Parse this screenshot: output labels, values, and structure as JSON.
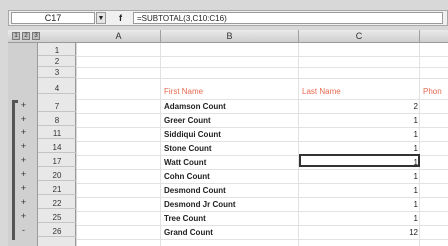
{
  "formula_bar": {
    "name_box": "C17",
    "fx": "f",
    "formula": "=SUBTOTAL(3,C10:C16)"
  },
  "outline_levels": [
    "1",
    "2",
    "3"
  ],
  "columns": [
    "A",
    "B",
    "C"
  ],
  "row_numbers": [
    "1",
    "2",
    "3",
    "4",
    "7",
    "8",
    "11",
    "14",
    "17",
    "20",
    "21",
    "22",
    "25",
    "26"
  ],
  "headers": {
    "first_name": "First Name",
    "last_name": "Last Name",
    "extra": "Phon"
  },
  "rows": [
    {
      "label": "Adamson Count",
      "value": "2"
    },
    {
      "label": "Greer Count",
      "value": "1"
    },
    {
      "label": "Siddiqui Count",
      "value": "1"
    },
    {
      "label": "Stone Count",
      "value": "1"
    },
    {
      "label": "Watt Count",
      "value": "1"
    },
    {
      "label": "Cohn Count",
      "value": "1"
    },
    {
      "label": "Desmond Count",
      "value": "1"
    },
    {
      "label": "Desmond Jr Count",
      "value": "1"
    },
    {
      "label": "Tree Count",
      "value": "1"
    },
    {
      "label": "Grand Count",
      "value": "12"
    }
  ],
  "plus_signs": [
    "+",
    "+",
    "+",
    "+",
    "+",
    "+",
    "+",
    "+",
    "+",
    "-"
  ]
}
